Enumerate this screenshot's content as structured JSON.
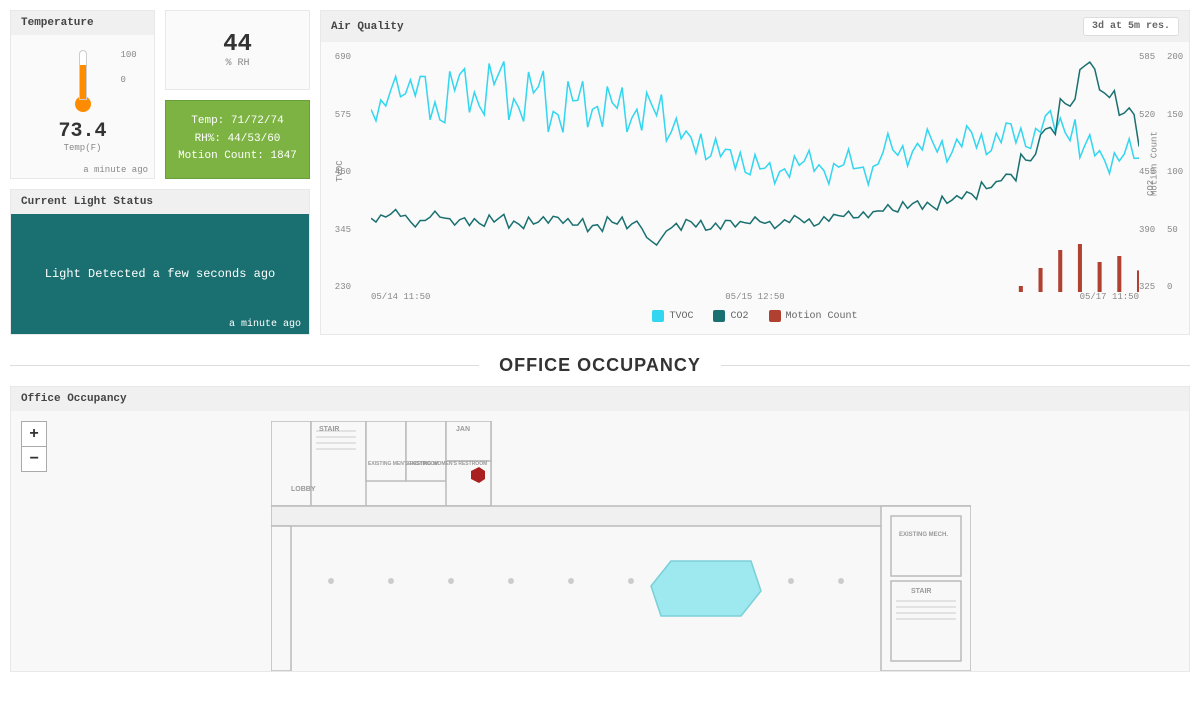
{
  "temperature": {
    "title": "Temperature",
    "value": "73.4",
    "unit": "Temp(F)",
    "updated": "a minute ago",
    "scale_max": "100",
    "scale_min": "0"
  },
  "humidity": {
    "value": "44",
    "unit": "% RH"
  },
  "stats": {
    "line1": "Temp: 71/72/74",
    "line2": "RH%: 44/53/60",
    "line3": "Motion Count: 1847"
  },
  "light": {
    "title": "Current Light Status",
    "message": "Light Detected a few seconds ago",
    "updated": "a minute ago"
  },
  "air": {
    "title": "Air Quality",
    "badge": "3d at 5m res.",
    "y_left_label": "TVOC",
    "y_right_label": "CO2",
    "y_right2_label": "Motion Count",
    "y_left_ticks": [
      "690",
      "575",
      "460",
      "345",
      "230"
    ],
    "y_right_ticks": [
      "585",
      "520",
      "455",
      "390",
      "325"
    ],
    "y_right2_ticks": [
      "200",
      "150",
      "100",
      "50",
      "0"
    ],
    "x_ticks": [
      "05/14 11:50",
      "05/15 12:50",
      "05/17 11:50"
    ],
    "legend": [
      {
        "label": "TVOC",
        "color": "#33d6f0"
      },
      {
        "label": "CO2",
        "color": "#1a7070"
      },
      {
        "label": "Motion Count",
        "color": "#b04030"
      }
    ]
  },
  "section_title": "OFFICE OCCUPANCY",
  "occupancy": {
    "title": "Office Occupancy",
    "zoom_in": "+",
    "zoom_out": "−",
    "rooms": {
      "stair1": "STAIR",
      "lobby": "LOBBY",
      "jan": "JAN",
      "mens": "EXISTING MEN'S RESTROOM",
      "womens": "EXISTING WOMEN'S RESTROOM",
      "mech": "EXISTING MECH.",
      "stair2": "STAIR"
    }
  },
  "chart_data": {
    "type": "line",
    "title": "Air Quality",
    "x_range": [
      "05/14 11:50",
      "05/17 11:50"
    ],
    "series": [
      {
        "name": "TVOC",
        "axis": "left",
        "yrange": [
          230,
          690
        ],
        "values_approx": [
          580,
          620,
          630,
          570,
          640,
          590,
          650,
          580,
          630,
          560,
          610,
          570,
          600,
          560,
          590,
          540,
          520,
          500,
          490,
          470,
          460,
          470,
          480,
          460,
          480,
          460,
          510,
          495,
          520,
          500,
          530,
          510,
          540,
          520,
          560,
          540,
          510,
          480,
          500,
          470
        ]
      },
      {
        "name": "CO2",
        "axis": "right",
        "yrange": [
          325,
          585
        ],
        "values_approx": [
          405,
          410,
          400,
          408,
          402,
          400,
          405,
          398,
          402,
          404,
          400,
          395,
          402,
          398,
          380,
          395,
          400,
          395,
          400,
          402,
          398,
          404,
          400,
          406,
          408,
          410,
          415,
          420,
          418,
          425,
          430,
          440,
          450,
          470,
          500,
          530,
          570,
          540,
          520,
          480
        ]
      },
      {
        "name": "Motion Count",
        "axis": "right2",
        "yrange": [
          0,
          200
        ],
        "values_approx": [
          0,
          0,
          0,
          0,
          0,
          0,
          0,
          0,
          0,
          0,
          0,
          0,
          0,
          0,
          0,
          0,
          0,
          0,
          0,
          0,
          0,
          0,
          0,
          0,
          0,
          0,
          0,
          0,
          0,
          0,
          0,
          0,
          0,
          5,
          20,
          35,
          40,
          25,
          30,
          18
        ]
      }
    ]
  }
}
